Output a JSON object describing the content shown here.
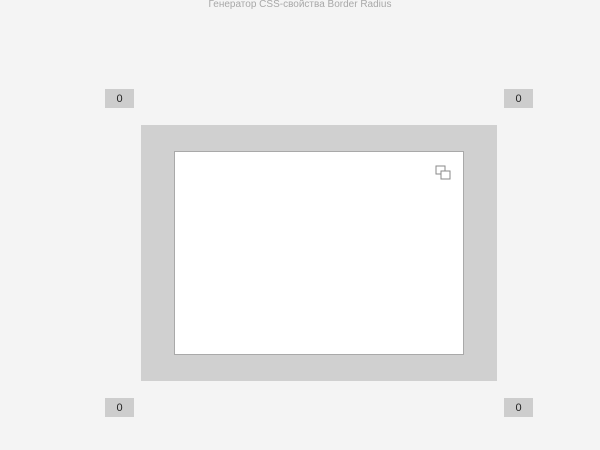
{
  "header": {
    "title": "Генератор CSS-свойства Border Radius"
  },
  "radius": {
    "top_left": "0",
    "top_right": "0",
    "bottom_left": "0",
    "bottom_right": "0"
  },
  "preview": {
    "outer_color": "#d0d0d0",
    "inner_color": "#ffffff",
    "copy_icon": "copy-icon"
  },
  "colors": {
    "background": "#f4f4f4",
    "input_bg": "#cdcdcd",
    "title_text": "#a8a8a8"
  }
}
